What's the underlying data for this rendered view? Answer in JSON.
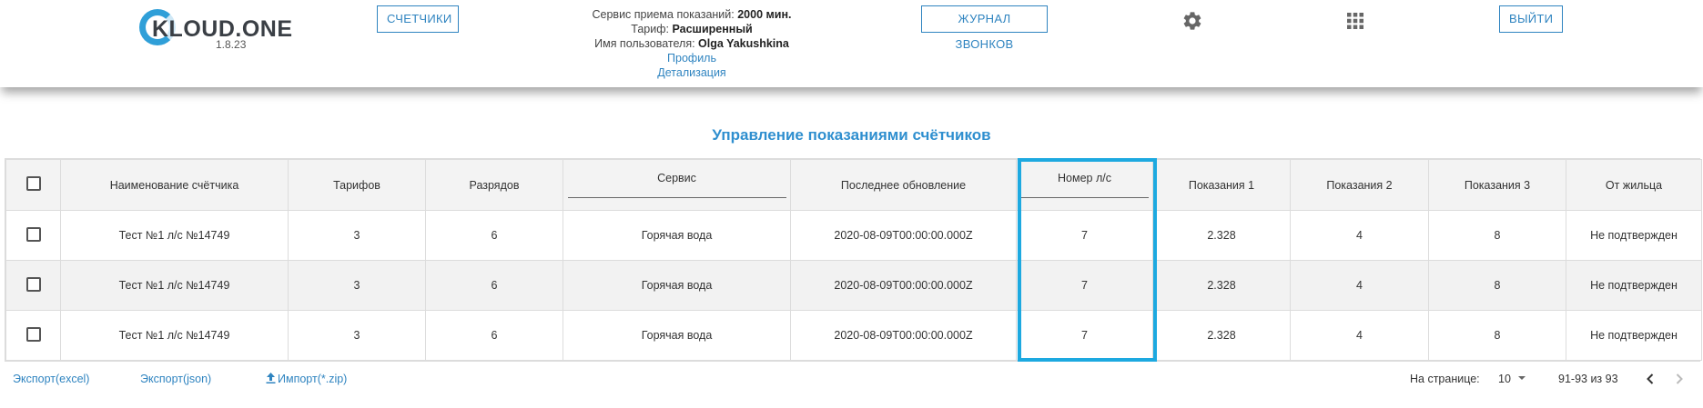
{
  "header": {
    "logo_text": "KLOUD.ONE",
    "version": "1.8.23",
    "meters_button": "СЧЕТЧИКИ",
    "calls_button": "ЖУРНАЛ ЗВОНКОВ",
    "logout_button": "ВЫЙТИ",
    "service_label": "Сервис приема показаний:",
    "service_value": "2000 мин.",
    "tariff_label": "Тариф:",
    "tariff_value": "Расширенный",
    "user_label": "Имя пользователя:",
    "user_value": "Olga Yakushkina",
    "profile_link": "Профиль",
    "details_link": "Детализация",
    "settings_icon": "gear-icon",
    "apps_icon": "grid-icon"
  },
  "page": {
    "title": "Управление показаниями счётчиков"
  },
  "table": {
    "columns": [
      "Наименование счётчика",
      "Тарифов",
      "Разрядов",
      "Сервис",
      "Последнее обновление",
      "Номер л/с",
      "Показания 1",
      "Показания 2",
      "Показания 3",
      "От жильца"
    ],
    "rows": [
      [
        "Тест №1 л/с №14749",
        "3",
        "6",
        "Горячая вода",
        "2020-08-09T00:00:00.000Z",
        "7",
        "2.328",
        "4",
        "8",
        "Не подтвержден"
      ],
      [
        "Тест №1 л/с №14749",
        "3",
        "6",
        "Горячая вода",
        "2020-08-09T00:00:00.000Z",
        "7",
        "2.328",
        "4",
        "8",
        "Не подтвержден"
      ],
      [
        "Тест №1 л/с №14749",
        "3",
        "6",
        "Горячая вода",
        "2020-08-09T00:00:00.000Z",
        "7",
        "2.328",
        "4",
        "8",
        "Не подтвержден"
      ]
    ]
  },
  "footer": {
    "export_excel": "Экспорт(excel)",
    "export_json": "Экспорт(json)",
    "import_zip": "Импорт(*.zip)",
    "per_page_label": "На странице:",
    "per_page_value": "10",
    "range": "91-93 из 93"
  },
  "colors": {
    "accent": "#2f84c0",
    "title": "#2f8fcf",
    "highlight": "#1da9e0"
  }
}
